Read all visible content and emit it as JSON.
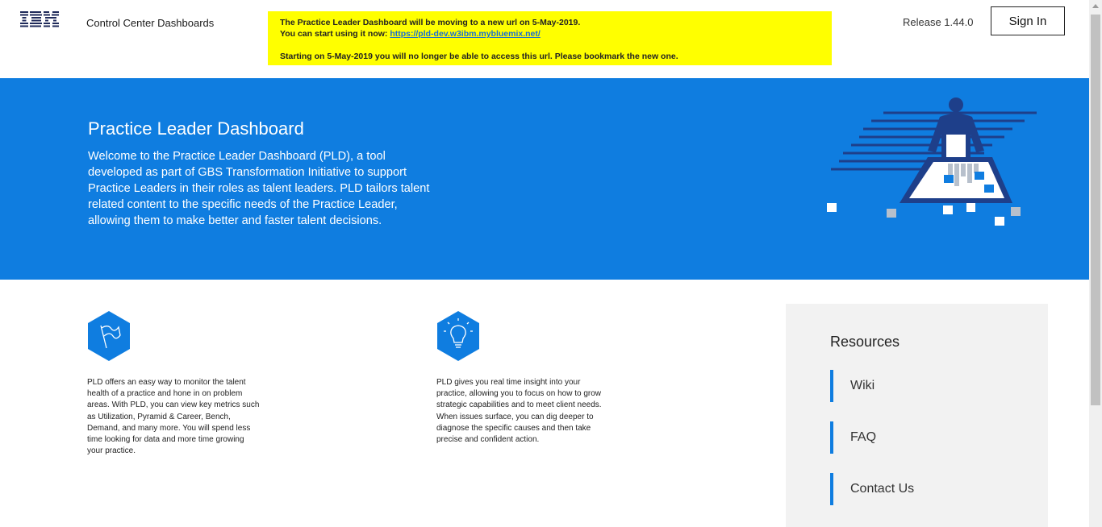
{
  "header": {
    "logo_text": "IBM",
    "app_title": "Control Center Dashboards",
    "release": "Release 1.44.0",
    "sign_in_label": "Sign In"
  },
  "notice": {
    "line1": "The Practice Leader Dashboard will be moving to a new url on 5-May-2019.",
    "line2_prefix": "You can start using it now: ",
    "link_text": "https://pld-dev.w3ibm.mybluemix.net/",
    "line3": "Starting on 5-May-2019 you will no longer be able to access this url. Please bookmark the new one.",
    "background_color": "#ffff00"
  },
  "hero": {
    "title": "Practice Leader Dashboard",
    "text": "Welcome to the Practice Leader Dashboard (PLD), a tool developed as part of GBS Transformation Initiative to support Practice Leaders in their roles as talent leaders. PLD tailors talent related content to the specific needs of the Practice Leader, allowing them to make better and faster talent decisions.",
    "background_color": "#0f7de0"
  },
  "features": [
    {
      "icon": "flag-icon",
      "text": "PLD offers an easy way to monitor the talent health of a practice and hone in on problem areas. With PLD, you can view key metrics such as Utilization, Pyramid & Career, Bench, Demand, and many more. You will spend less time looking for data and more time growing your practice."
    },
    {
      "icon": "lightbulb-icon",
      "text": "PLD gives you real time insight into your practice, allowing you to focus on how to grow strategic capabilities and to meet client needs. When issues surface, you can dig deeper to diagnose the specific causes and then take precise and confident action."
    }
  ],
  "resources": {
    "title": "Resources",
    "links": [
      "Wiki",
      "FAQ",
      "Contact Us"
    ]
  }
}
